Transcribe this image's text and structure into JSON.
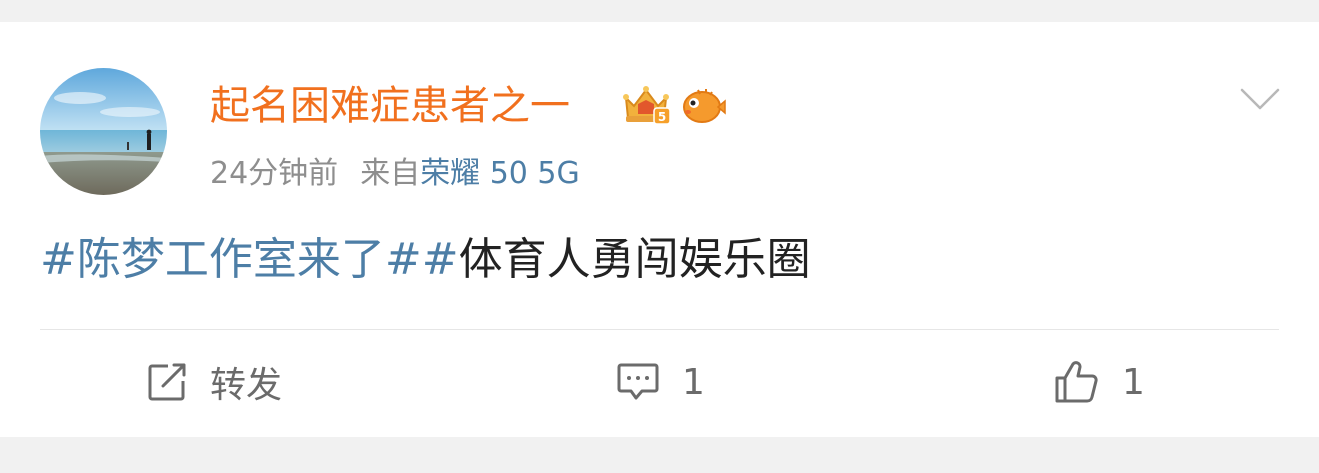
{
  "post": {
    "username": "起名困难症患者之一",
    "time": "24分钟前",
    "source_prefix": "来自",
    "device": "荣耀 50 5G",
    "content": {
      "topic1": "#陈梦工作室来了#",
      "topic2": "#",
      "text": "体育人勇闯娱乐圈"
    }
  },
  "actions": {
    "repost_label": "转发",
    "comment_count": "1",
    "like_count": "1"
  },
  "colors": {
    "username": "#f1701e",
    "link": "#4d7ea6",
    "meta": "#8e8e8e",
    "text": "#222222",
    "icon": "#6b6b6b"
  },
  "icons": {
    "badge1": "crown-level-badge-icon",
    "badge2": "pufferfish-badge-icon",
    "more": "chevron-down-icon",
    "repost": "share-edit-icon",
    "comment": "comment-icon",
    "like": "thumbs-up-icon"
  }
}
